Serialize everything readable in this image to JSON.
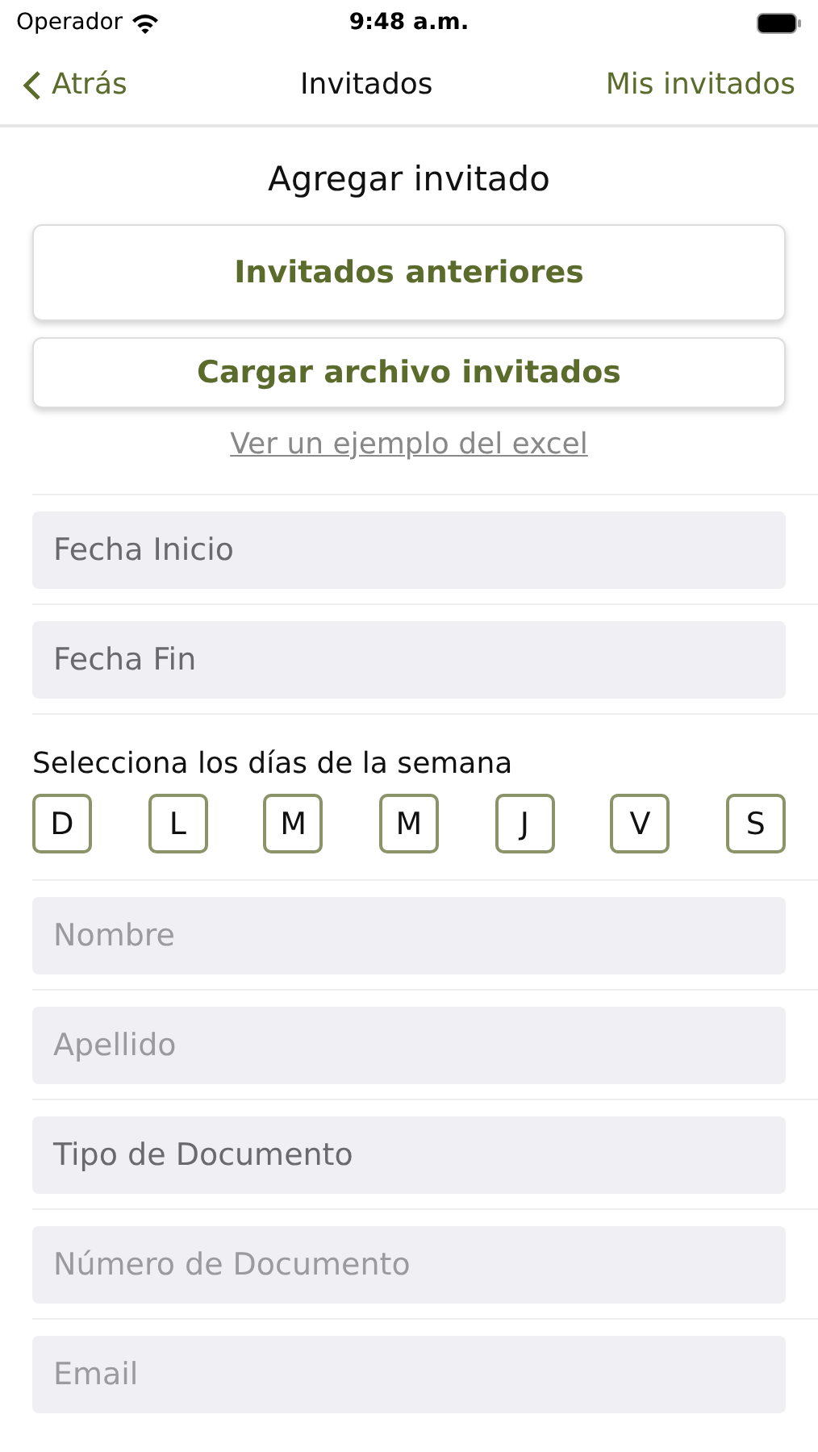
{
  "status_bar": {
    "carrier": "Operador",
    "time": "9:48 a.m."
  },
  "nav": {
    "back": "Atrás",
    "title": "Invitados",
    "action": "Mis invitados"
  },
  "section_title": "Agregar invitado",
  "buttons": [
    {
      "label": "Invitados anteriores",
      "kind": "tall"
    },
    {
      "label": "Cargar archivo invitados",
      "kind": "short"
    }
  ],
  "example_link": "Ver un ejemplo del excel",
  "date_fields": [
    {
      "kind": "picker",
      "placeholder": "Fecha Inicio"
    },
    {
      "kind": "picker",
      "placeholder": "Fecha Fin"
    }
  ],
  "days": {
    "label": "Selecciona los días de la semana",
    "items": [
      {
        "label": "D",
        "selected": false
      },
      {
        "label": "L",
        "selected": false
      },
      {
        "label": "M",
        "selected": false
      },
      {
        "label": "M",
        "selected": false
      },
      {
        "label": "J",
        "selected": false
      },
      {
        "label": "V",
        "selected": false
      },
      {
        "label": "S",
        "selected": false
      }
    ]
  },
  "fields": [
    {
      "kind": "text",
      "placeholder": "Nombre"
    },
    {
      "kind": "text",
      "placeholder": "Apellido"
    },
    {
      "kind": "picker",
      "placeholder": "Tipo de Documento"
    },
    {
      "kind": "text",
      "placeholder": "Número de Documento"
    },
    {
      "kind": "text",
      "placeholder": "Email"
    }
  ]
}
